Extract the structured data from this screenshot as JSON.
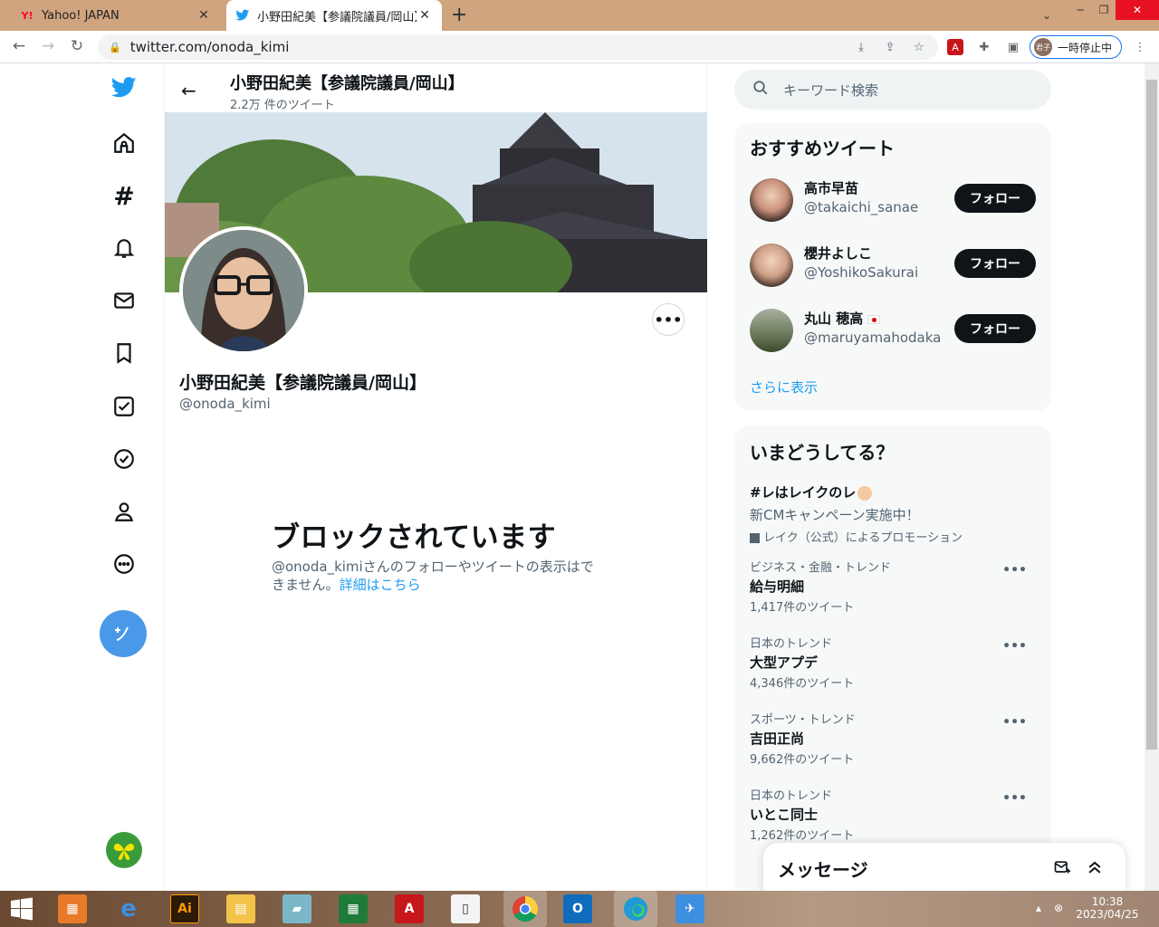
{
  "browser": {
    "tabs": [
      {
        "label": "Yahoo! JAPAN",
        "favicon": "Y!"
      },
      {
        "label": "小野田紀美【参議院議員/岡山】(",
        "favicon": "twitter-bird"
      }
    ],
    "new_tab": "+",
    "url": "twitter.com/onoda_kimi",
    "profile_label": "一時停止中",
    "profile_avatar": "君子"
  },
  "profile_header": {
    "name": "小野田紀美【参議院議員/岡山】",
    "tweet_count": "2.2万 件のツイート"
  },
  "profile": {
    "name": "小野田紀美【参議院議員/岡山】",
    "handle": "@onoda_kimi",
    "more": "•••"
  },
  "blocked": {
    "title": "ブロックされています",
    "text": "@onoda_kimiさんのフォローやツイートの表示はできません。",
    "link": "詳細はこちら"
  },
  "search": {
    "placeholder": "キーワード検索"
  },
  "who_to_follow": {
    "title": "おすすめツイート",
    "follow_label": "フォロー",
    "users": [
      {
        "name": "高市早苗",
        "handle": "@takaichi_sanae"
      },
      {
        "name": "櫻井よしこ",
        "handle": "@YoshikoSakurai"
      },
      {
        "name": "丸山 穂高",
        "handle": "@maruyamahodaka"
      }
    ],
    "show_more": "さらに表示"
  },
  "trends": {
    "title": "いまどうしてる？",
    "promo": {
      "title": "#レはレイクのレ",
      "desc": "新CMキャンペーン実施中！",
      "by": "レイク（公式）によるプロモーション"
    },
    "items": [
      {
        "category": "ビジネス・金融・トレンド",
        "topic": "給与明細",
        "count": "1,417件のツイート"
      },
      {
        "category": "日本のトレンド",
        "topic": "大型アプデ",
        "count": "4,346件のツイート"
      },
      {
        "category": "スポーツ・トレンド",
        "topic": "吉田正尚",
        "count": "9,662件のツイート"
      },
      {
        "category": "日本のトレンド",
        "topic": "いとこ同士",
        "count": "1,262件のツイート"
      }
    ],
    "more_dots": "•••"
  },
  "messages": {
    "title": "メッセージ"
  },
  "taskbar": {
    "time": "10:38",
    "date": "2023/04/25",
    "apps": [
      "windows-start",
      "app-launcher",
      "internet-explorer",
      "illustrator",
      "file-explorer",
      "notebook",
      "excel",
      "acrobat",
      "document-viewer",
      "chrome",
      "outlook",
      "edge",
      "airplane-app"
    ],
    "illustrator_label": "Ai"
  },
  "colors": {
    "twitter_blue": "#1d9bf0",
    "tab_bar": "#cfa47e",
    "close_red": "#e81123"
  }
}
